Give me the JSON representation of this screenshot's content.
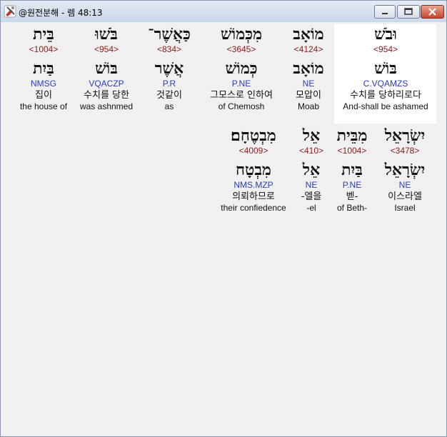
{
  "window": {
    "title": "@원전분해 - 렘 48:13",
    "icon": "app-tools-icon"
  },
  "row1": [
    {
      "hebrew": "בֵּית",
      "strong": "<1004>",
      "lemma": "בַּיִת",
      "morph": "NMSG",
      "korean": "집이",
      "english": "the house of"
    },
    {
      "hebrew": "בֹּשׁוּ",
      "strong": "<954>",
      "lemma": "בּוֹשׁ",
      "morph": "VQACZP",
      "korean": "수치를 당한",
      "english": "was ashnmed"
    },
    {
      "hebrew": "כַּאֲשֶׁר־",
      "strong": "<834>",
      "lemma": "אֲשֶׁר",
      "morph": "P.R",
      "korean": "것같이",
      "english": "as"
    },
    {
      "hebrew": "מִכְּמוֹשׁ",
      "strong": "<3645>",
      "lemma": "כְּמוֹשׁ",
      "morph": "P.NE",
      "korean": "그모스로 인하여",
      "english": "of Chemosh"
    },
    {
      "hebrew": "מוֹאָב",
      "strong": "<4124>",
      "lemma": "מוֹאָב",
      "morph": "NE",
      "korean": "모압이",
      "english": "Moab"
    },
    {
      "hebrew": "וּבֹשׁ",
      "strong": "<954>",
      "lemma": "בּוֹשׁ",
      "morph": "C.VQAMZS",
      "korean": "수치를 당하리로다",
      "english": "And-shall be ashamed"
    }
  ],
  "row2": [
    {
      "hebrew": "מִבְטֶחָם׃",
      "strong": "<4009>",
      "lemma": "מִבְטָח",
      "morph": "NMS.MZP",
      "korean": "의뢰하므로",
      "english": "their confiedence"
    },
    {
      "hebrew": "אֵל",
      "strong": "<410>",
      "lemma": "אֵל",
      "morph": "NE",
      "korean": "-엘을",
      "english": "-el"
    },
    {
      "hebrew": "מִבֵּית",
      "strong": "<1004>",
      "lemma": "בַּיִת",
      "morph": "P.NE",
      "korean": "벧-",
      "english": "of Beth-"
    },
    {
      "hebrew": "יִשְׂרָאֵל",
      "strong": "<3478>",
      "lemma": "יִשְׂרָאֵל",
      "morph": "NE",
      "korean": "이스라엘",
      "english": "Israel"
    }
  ]
}
